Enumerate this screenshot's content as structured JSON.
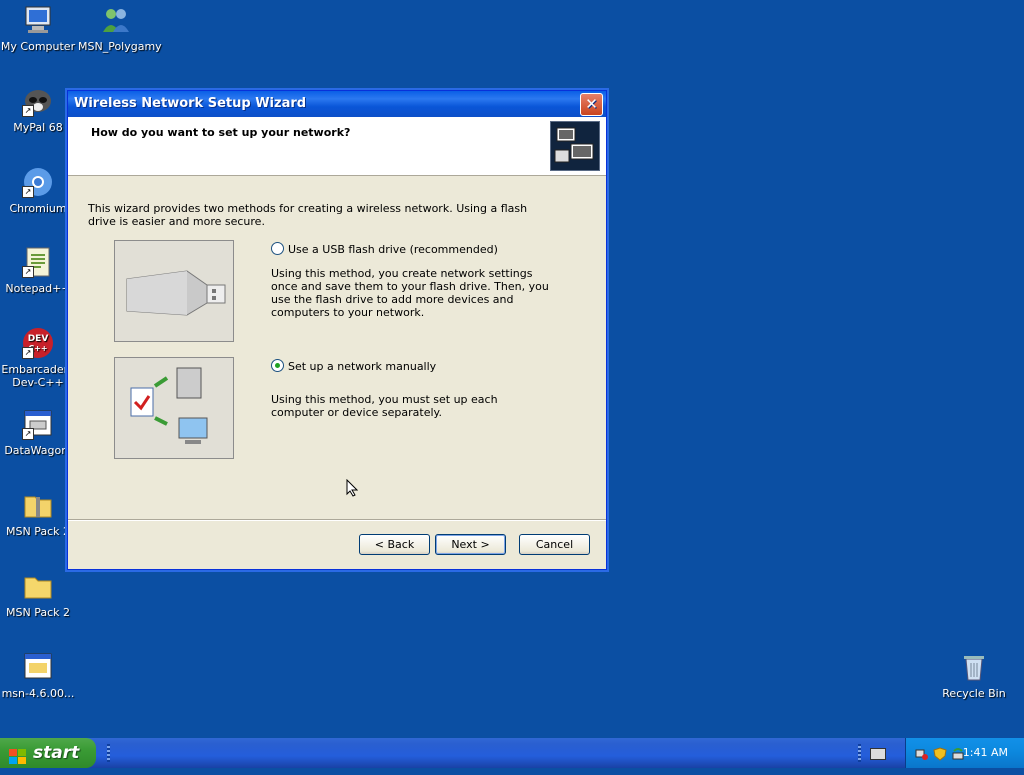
{
  "desktop": {
    "icons": [
      {
        "label": "My Computer"
      },
      {
        "label": "MSN_Polygamy"
      },
      {
        "label": "MyPal 68"
      },
      {
        "label": "Chromium"
      },
      {
        "label": "Notepad++"
      },
      {
        "label": "Embarcadero Dev-C++"
      },
      {
        "label": "DataWagon."
      },
      {
        "label": "MSN Pack 2"
      },
      {
        "label": "MSN Pack 2"
      },
      {
        "label": "msn-4.6.00..."
      },
      {
        "label": "Recycle Bin"
      }
    ]
  },
  "window": {
    "title": "Wireless Network Setup Wizard",
    "close_label": "✕",
    "header_title": "How do you want to set up your network?",
    "intro": "This wizard provides two methods for creating a wireless network. Using a flash drive is easier and more secure.",
    "options": [
      {
        "label": "Use a USB flash drive (recommended)",
        "selected": false,
        "description": "Using this method, you create network settings once and save them to your flash drive. Then, you use the flash drive to add more devices and computers to your network."
      },
      {
        "label": "Set up a network manually",
        "selected": true,
        "description": "Using this method, you must set up each computer or device separately."
      }
    ],
    "buttons": {
      "back": "< Back",
      "next": "Next >",
      "cancel": "Cancel"
    }
  },
  "taskbar": {
    "start_label": "start",
    "clock": "1:41 AM"
  },
  "colors": {
    "desktop": "#0b4fa3",
    "titlebar": "#0a5fe6",
    "start": "#3a9b35",
    "tray": "#0d8ae0"
  }
}
